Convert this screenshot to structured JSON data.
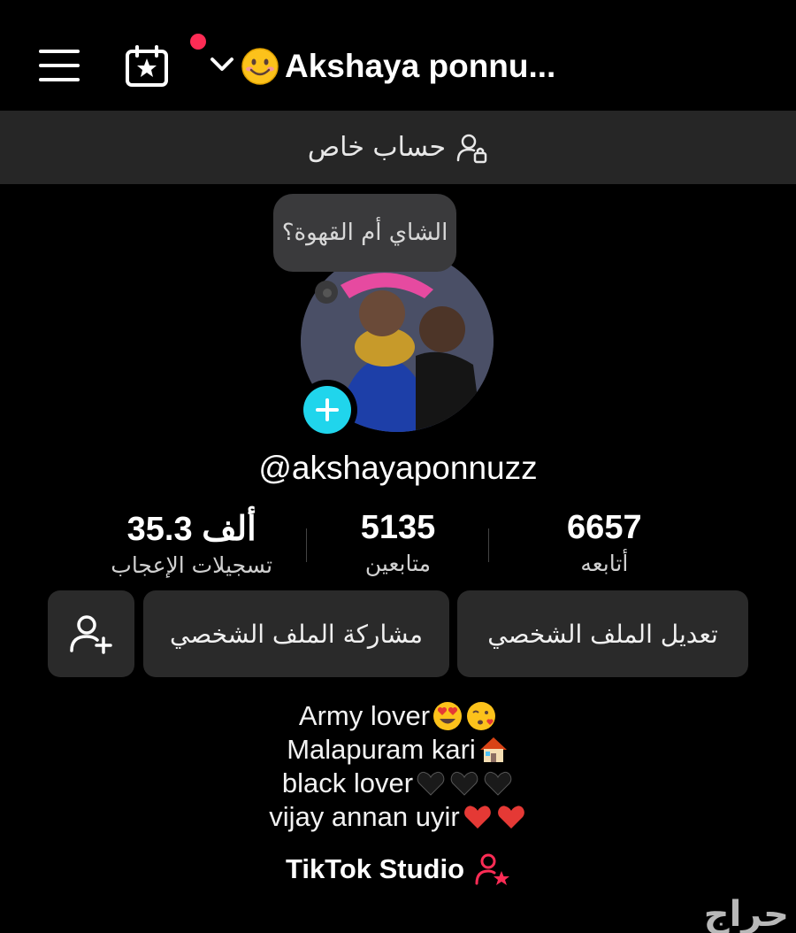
{
  "header": {
    "title": "Akshaya ponnu...",
    "menu_icon": "hamburger-menu-icon",
    "calendar_icon": "calendar-star-icon",
    "dropdown_icon": "chevron-down-icon",
    "notification_color": "#fe2c55"
  },
  "private_banner": {
    "label": "حساب خاص",
    "icon": "user-lock-icon"
  },
  "profile": {
    "note": "الشاي أم القهوة؟",
    "username": "@akshayaponnuzz",
    "add_photo_icon": "plus-icon"
  },
  "stats": [
    {
      "value": "6657",
      "label": "أتابعه"
    },
    {
      "value": "5135",
      "label": "متابعين"
    },
    {
      "value": "35.3 ألف",
      "label": "تسجيلات الإعجاب"
    }
  ],
  "actions": {
    "edit_profile": "تعديل الملف الشخصي",
    "share_profile": "مشاركة الملف الشخصي",
    "add_friend_icon": "add-user-icon"
  },
  "bio": {
    "line1": "Army lover",
    "line2": "Malapuram kari",
    "line3": "black lover",
    "line4": "vijay annan uyir"
  },
  "studio": {
    "label": "TikTok Studio",
    "icon_color": "#fe2c55"
  },
  "watermark": "حراج",
  "colors": {
    "accent": "#fe2c55",
    "add_button": "#20d5ec",
    "banner_bg": "#262626",
    "button_bg": "#2a2a2a"
  }
}
